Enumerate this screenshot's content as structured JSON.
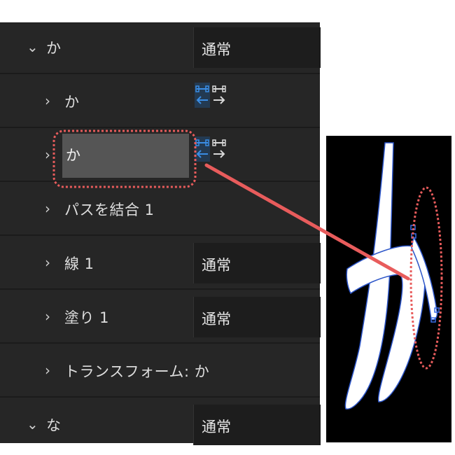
{
  "layers": [
    {
      "name": "か",
      "expanded": true,
      "blend": "通常"
    },
    {
      "name": "か",
      "expanded": false,
      "toggles": [
        "selected",
        "plain"
      ]
    },
    {
      "name": "か",
      "expanded": false,
      "selected": true,
      "toggles": [
        "selected",
        "plain"
      ]
    },
    {
      "name": "パスを結合 1",
      "expanded": false
    },
    {
      "name": "線 1",
      "expanded": false,
      "blend": "通常"
    },
    {
      "name": "塗り 1",
      "expanded": false,
      "blend": "通常"
    },
    {
      "name": "トランスフォーム: か",
      "expanded": false
    },
    {
      "name": "な",
      "expanded": true,
      "blend": "通常"
    }
  ],
  "icons": {
    "expanded": "chevron-down-icon",
    "collapsed": "chevron-right-icon",
    "toggle": "path-direction-toggle-icon"
  },
  "preview": {
    "glyph": "か"
  },
  "colors": {
    "panel_bg": "#262626",
    "selection": "#555555",
    "accent_blue": "#3a8ee6",
    "annotation_red": "#e85c5c"
  }
}
